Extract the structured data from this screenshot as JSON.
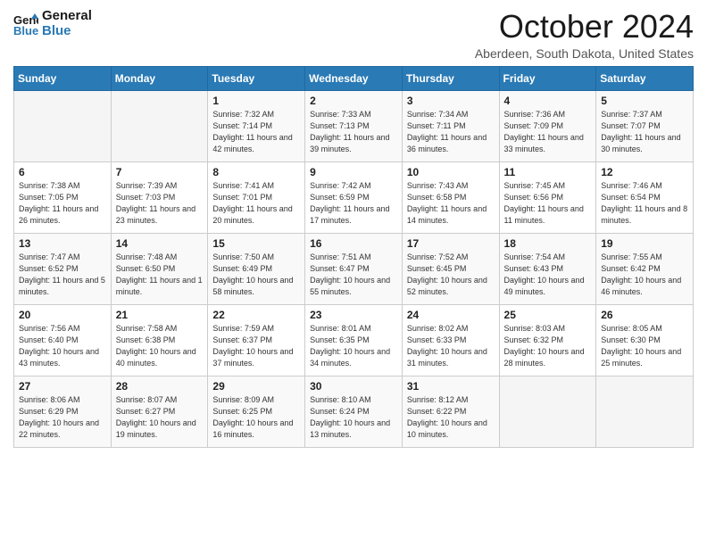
{
  "logo": {
    "line1": "General",
    "line2": "Blue"
  },
  "title": "October 2024",
  "subtitle": "Aberdeen, South Dakota, United States",
  "days_of_week": [
    "Sunday",
    "Monday",
    "Tuesday",
    "Wednesday",
    "Thursday",
    "Friday",
    "Saturday"
  ],
  "weeks": [
    [
      {
        "day": "",
        "info": ""
      },
      {
        "day": "",
        "info": ""
      },
      {
        "day": "1",
        "info": "Sunrise: 7:32 AM\nSunset: 7:14 PM\nDaylight: 11 hours and 42 minutes."
      },
      {
        "day": "2",
        "info": "Sunrise: 7:33 AM\nSunset: 7:13 PM\nDaylight: 11 hours and 39 minutes."
      },
      {
        "day": "3",
        "info": "Sunrise: 7:34 AM\nSunset: 7:11 PM\nDaylight: 11 hours and 36 minutes."
      },
      {
        "day": "4",
        "info": "Sunrise: 7:36 AM\nSunset: 7:09 PM\nDaylight: 11 hours and 33 minutes."
      },
      {
        "day": "5",
        "info": "Sunrise: 7:37 AM\nSunset: 7:07 PM\nDaylight: 11 hours and 30 minutes."
      }
    ],
    [
      {
        "day": "6",
        "info": "Sunrise: 7:38 AM\nSunset: 7:05 PM\nDaylight: 11 hours and 26 minutes."
      },
      {
        "day": "7",
        "info": "Sunrise: 7:39 AM\nSunset: 7:03 PM\nDaylight: 11 hours and 23 minutes."
      },
      {
        "day": "8",
        "info": "Sunrise: 7:41 AM\nSunset: 7:01 PM\nDaylight: 11 hours and 20 minutes."
      },
      {
        "day": "9",
        "info": "Sunrise: 7:42 AM\nSunset: 6:59 PM\nDaylight: 11 hours and 17 minutes."
      },
      {
        "day": "10",
        "info": "Sunrise: 7:43 AM\nSunset: 6:58 PM\nDaylight: 11 hours and 14 minutes."
      },
      {
        "day": "11",
        "info": "Sunrise: 7:45 AM\nSunset: 6:56 PM\nDaylight: 11 hours and 11 minutes."
      },
      {
        "day": "12",
        "info": "Sunrise: 7:46 AM\nSunset: 6:54 PM\nDaylight: 11 hours and 8 minutes."
      }
    ],
    [
      {
        "day": "13",
        "info": "Sunrise: 7:47 AM\nSunset: 6:52 PM\nDaylight: 11 hours and 5 minutes."
      },
      {
        "day": "14",
        "info": "Sunrise: 7:48 AM\nSunset: 6:50 PM\nDaylight: 11 hours and 1 minute."
      },
      {
        "day": "15",
        "info": "Sunrise: 7:50 AM\nSunset: 6:49 PM\nDaylight: 10 hours and 58 minutes."
      },
      {
        "day": "16",
        "info": "Sunrise: 7:51 AM\nSunset: 6:47 PM\nDaylight: 10 hours and 55 minutes."
      },
      {
        "day": "17",
        "info": "Sunrise: 7:52 AM\nSunset: 6:45 PM\nDaylight: 10 hours and 52 minutes."
      },
      {
        "day": "18",
        "info": "Sunrise: 7:54 AM\nSunset: 6:43 PM\nDaylight: 10 hours and 49 minutes."
      },
      {
        "day": "19",
        "info": "Sunrise: 7:55 AM\nSunset: 6:42 PM\nDaylight: 10 hours and 46 minutes."
      }
    ],
    [
      {
        "day": "20",
        "info": "Sunrise: 7:56 AM\nSunset: 6:40 PM\nDaylight: 10 hours and 43 minutes."
      },
      {
        "day": "21",
        "info": "Sunrise: 7:58 AM\nSunset: 6:38 PM\nDaylight: 10 hours and 40 minutes."
      },
      {
        "day": "22",
        "info": "Sunrise: 7:59 AM\nSunset: 6:37 PM\nDaylight: 10 hours and 37 minutes."
      },
      {
        "day": "23",
        "info": "Sunrise: 8:01 AM\nSunset: 6:35 PM\nDaylight: 10 hours and 34 minutes."
      },
      {
        "day": "24",
        "info": "Sunrise: 8:02 AM\nSunset: 6:33 PM\nDaylight: 10 hours and 31 minutes."
      },
      {
        "day": "25",
        "info": "Sunrise: 8:03 AM\nSunset: 6:32 PM\nDaylight: 10 hours and 28 minutes."
      },
      {
        "day": "26",
        "info": "Sunrise: 8:05 AM\nSunset: 6:30 PM\nDaylight: 10 hours and 25 minutes."
      }
    ],
    [
      {
        "day": "27",
        "info": "Sunrise: 8:06 AM\nSunset: 6:29 PM\nDaylight: 10 hours and 22 minutes."
      },
      {
        "day": "28",
        "info": "Sunrise: 8:07 AM\nSunset: 6:27 PM\nDaylight: 10 hours and 19 minutes."
      },
      {
        "day": "29",
        "info": "Sunrise: 8:09 AM\nSunset: 6:25 PM\nDaylight: 10 hours and 16 minutes."
      },
      {
        "day": "30",
        "info": "Sunrise: 8:10 AM\nSunset: 6:24 PM\nDaylight: 10 hours and 13 minutes."
      },
      {
        "day": "31",
        "info": "Sunrise: 8:12 AM\nSunset: 6:22 PM\nDaylight: 10 hours and 10 minutes."
      },
      {
        "day": "",
        "info": ""
      },
      {
        "day": "",
        "info": ""
      }
    ]
  ]
}
